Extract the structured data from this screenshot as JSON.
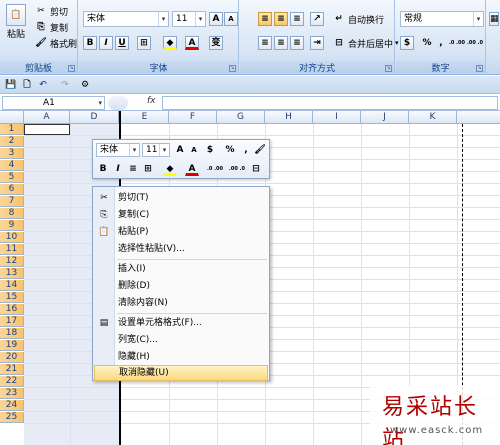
{
  "ribbon": {
    "clipboard": {
      "label": "剪贴板",
      "paste": "粘贴",
      "cut": "剪切",
      "copy": "复制",
      "format_painter": "格式刷"
    },
    "font": {
      "label": "字体",
      "font_name": "宋体",
      "font_size": "11",
      "bold": "B",
      "italic": "I",
      "underline": "U",
      "grow": "A",
      "shrink": "A",
      "phonetic": "变"
    },
    "alignment": {
      "label": "对齐方式",
      "wrap_text": "自动换行",
      "merge_center": "合并后居中"
    },
    "number": {
      "label": "数字",
      "format": "常规",
      "percent": "%",
      "comma": ",",
      "inc_decimal": ".0 .00",
      "dec_decimal": ".00 .0"
    }
  },
  "formula_bar": {
    "name_box": "A1",
    "fx": "fx"
  },
  "columns": [
    "A",
    "D",
    "E",
    "F",
    "G",
    "H",
    "I",
    "J",
    "K"
  ],
  "rows": [
    "1",
    "2",
    "3",
    "4",
    "5",
    "6",
    "7",
    "8",
    "9",
    "10",
    "11",
    "12",
    "13",
    "14",
    "15",
    "16",
    "17",
    "18",
    "19",
    "20",
    "21",
    "22",
    "23",
    "24",
    "25"
  ],
  "mini_toolbar": {
    "font_name": "宋体",
    "font_size": "11",
    "grow": "A",
    "shrink": "A",
    "percent": "%",
    "comma": ",",
    "bold": "B",
    "italic": "I",
    "inc_decimal": ".0 .00",
    "dec_decimal": ".00 .0"
  },
  "context_menu": {
    "items": [
      {
        "label": "剪切(T)",
        "icon": "cut-icon"
      },
      {
        "label": "复制(C)",
        "icon": "copy-icon"
      },
      {
        "label": "粘贴(P)",
        "icon": "paste-icon"
      },
      {
        "label": "选择性粘贴(V)...",
        "icon": ""
      },
      {
        "label": "插入(I)",
        "icon": ""
      },
      {
        "label": "删除(D)",
        "icon": ""
      },
      {
        "label": "清除内容(N)",
        "icon": ""
      },
      {
        "label": "设置单元格格式(F)...",
        "icon": "format-cells-icon"
      },
      {
        "label": "列宽(C)...",
        "icon": ""
      },
      {
        "label": "隐藏(H)",
        "icon": ""
      },
      {
        "label": "取消隐藏(U)",
        "icon": ""
      }
    ]
  },
  "watermark": {
    "title": "易采站长站",
    "url": "www.easck.com"
  },
  "colors": {
    "accent": "#15428b",
    "row_header": "#f8c36e",
    "hover": "#fbd97d"
  }
}
